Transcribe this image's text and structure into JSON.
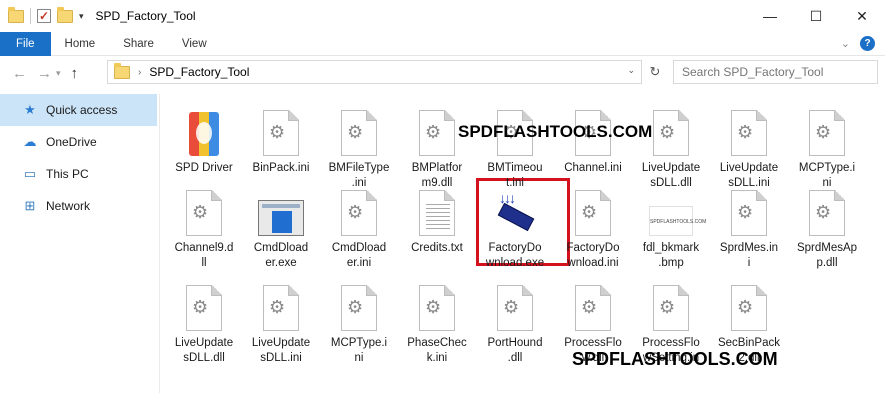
{
  "window": {
    "title": "SPD_Factory_Tool",
    "controls": {
      "minimize": "—",
      "maximize": "☐",
      "close": "✕"
    }
  },
  "ribbon": {
    "tabs": [
      "File",
      "Home",
      "Share",
      "View"
    ]
  },
  "address": {
    "path": "SPD_Factory_Tool",
    "search_placeholder": "Search SPD_Factory_Tool"
  },
  "navpane": {
    "items": [
      {
        "label": "Quick access",
        "icon": "star-icon"
      },
      {
        "label": "OneDrive",
        "icon": "cloud-icon"
      },
      {
        "label": "This PC",
        "icon": "computer-icon"
      },
      {
        "label": "Network",
        "icon": "network-icon"
      }
    ]
  },
  "files": [
    {
      "name": "SPD Driver",
      "icon": "spd-driver-icon"
    },
    {
      "name": "BinPack.ini",
      "icon": "settings-file-icon"
    },
    {
      "name": "BMFileType.ini",
      "icon": "settings-file-icon"
    },
    {
      "name": "BMPlatform9.dll",
      "icon": "settings-file-icon"
    },
    {
      "name": "BMTimeout.ini",
      "icon": "settings-file-icon"
    },
    {
      "name": "Channel.ini",
      "icon": "settings-file-icon"
    },
    {
      "name": "LiveUpdatesDLL.dll",
      "icon": "settings-file-icon"
    },
    {
      "name": "LiveUpdatesDLL.ini",
      "icon": "settings-file-icon"
    },
    {
      "name": "MCPType.ini",
      "icon": "settings-file-icon"
    },
    {
      "name": "Channel9.dll",
      "icon": "settings-file-icon"
    },
    {
      "name": "CmdDloader.exe",
      "icon": "window-app-icon"
    },
    {
      "name": "CmdDloader.ini",
      "icon": "settings-file-icon"
    },
    {
      "name": "Credits.txt",
      "icon": "text-file-icon"
    },
    {
      "name": "FactoryDownload.exe",
      "icon": "factory-download-icon"
    },
    {
      "name": "FactoryDownload.ini",
      "icon": "settings-file-icon"
    },
    {
      "name": "fdl_bkmark.bmp",
      "icon": "bitmap-icon"
    },
    {
      "name": "SprdMes.ini",
      "icon": "settings-file-icon"
    },
    {
      "name": "SprdMesApp.dll",
      "icon": "settings-file-icon"
    },
    {
      "name": "LiveUpdatesDLL.dll",
      "icon": "settings-file-icon"
    },
    {
      "name": "LiveUpdatesDLL.ini",
      "icon": "settings-file-icon"
    },
    {
      "name": "MCPType.ini",
      "icon": "settings-file-icon"
    },
    {
      "name": "PhaseCheck.ini",
      "icon": "settings-file-icon"
    },
    {
      "name": "PortHound.dll",
      "icon": "settings-file-icon"
    },
    {
      "name": "ProcessFlow.dll",
      "icon": "settings-file-icon"
    },
    {
      "name": "ProcessFlowSetting.ini",
      "icon": "settings-file-icon"
    },
    {
      "name": "SecBinPack2.dll",
      "icon": "settings-file-icon"
    }
  ],
  "file_labels_display": [
    "SPD Driver",
    "BinPack.ini",
    "BMFileType\n.ini",
    "BMPlatfor\nm9.dll",
    "BMTimeou\nt.ini",
    "Channel.ini",
    "LiveUpdate\nsDLL.dll",
    "LiveUpdate\nsDLL.ini",
    "MCPType.i\nni",
    "Channel9.d\nll",
    "CmdDload\ner.exe",
    "CmdDload\ner.ini",
    "Credits.txt",
    "FactoryDo\nwnload.exe",
    "FactoryDo\nwnload.ini",
    "fdl_bkmark\n.bmp",
    "SprdMes.in\ni",
    "SprdMesAp\np.dll",
    "LiveUpdate\nsDLL.dll",
    "LiveUpdate\nsDLL.ini",
    "MCPType.i\nni",
    "PhaseChec\nk.ini",
    "PortHound\n.dll",
    "ProcessFlo\nw.dll",
    "ProcessFlo\nwSetting.in",
    "SecBinPack\n2.dll"
  ],
  "watermark": "SPDFLASHTOOLS.COM",
  "bmp_thumb_text": "SPDFLASHTOOLS.COM",
  "highlight_color": "#d4121e",
  "accent": "#1a6fc7"
}
